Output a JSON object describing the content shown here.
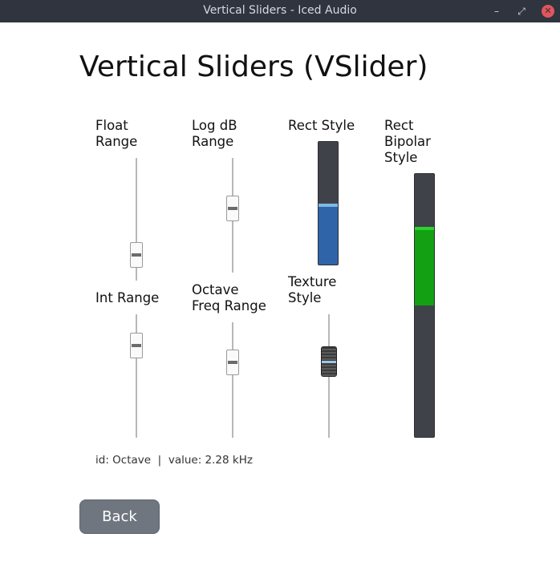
{
  "window": {
    "title": "Vertical Sliders - Iced Audio",
    "minimize_icon": "minimize-icon",
    "maximize_icon": "restore-icon",
    "close_icon": "close-icon"
  },
  "page_title": "Vertical Sliders (VSlider)",
  "sliders": {
    "float_range": {
      "label_line1": "Float",
      "label_line2": "Range",
      "value": 0.18
    },
    "log_db_range": {
      "label_line1": "Log dB",
      "label_line2": "Range",
      "value": 0.55
    },
    "rect_style": {
      "label": "Rect Style",
      "value": 0.5
    },
    "rect_bipolar": {
      "label_line1": "Rect",
      "label_line2": "Bipolar",
      "label_line3": "Style",
      "value": 0.83
    },
    "int_range": {
      "label": "Int Range",
      "value": 0.8
    },
    "octave_freq": {
      "label_line1": "Octave",
      "label_line2": "Freq Range",
      "value": 0.65
    },
    "texture_style": {
      "label_line1": "Texture",
      "label_line2": "Style",
      "value": 0.62
    }
  },
  "status": {
    "id_text": "id: Octave",
    "separator": "|",
    "value_text": "value: 2.28 kHz"
  },
  "back_button": {
    "label": "Back"
  },
  "colors": {
    "titlebar": "#2f343f",
    "rect_track": "#404249",
    "rect_fill": "#2f64a8",
    "bipolar_fill": "#13a013",
    "button": "#6f7680"
  }
}
